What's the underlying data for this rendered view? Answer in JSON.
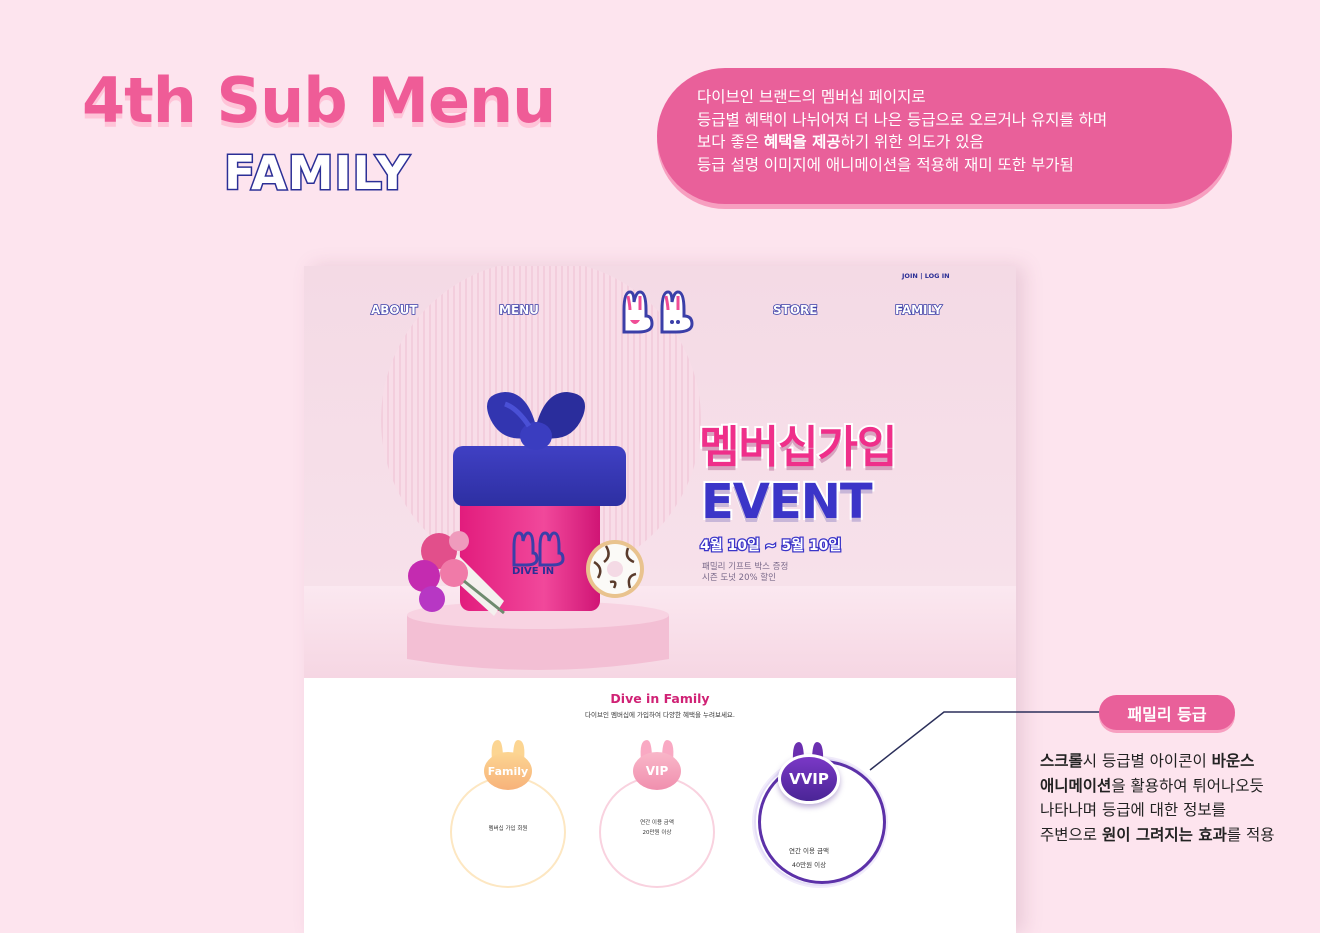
{
  "header": {
    "title": "4th Sub Menu",
    "subtitle": "FAMILY"
  },
  "description": {
    "line1": "다이브인 브랜드의 멤버십 페이지로",
    "line2": "등급별 혜택이 나뉘어져 더 나은 등급으로 오르거나 유지를 하며",
    "line3_pre": "보다 좋은 ",
    "line3_bold": "혜택을 제공",
    "line3_post": "하기 위한 의도가 있음",
    "line4": "등급 설명 이미지에 애니메이션을 적용해 재미 또한 부가됨"
  },
  "mockup": {
    "join_login": "JOIN | LOG IN",
    "nav": {
      "about": "ABOUT",
      "menu": "MENU",
      "store": "STORE",
      "family": "FAMILY"
    },
    "hero": {
      "event_title": "멤버십가입",
      "event_sub": "EVENT",
      "event_date": "4월 10일 ~ 5월 10일",
      "event_desc_1": "패밀리 기프트 박스 증정",
      "event_desc_2": "시즌 도넛 20% 할인",
      "box_brand": "DIVE IN"
    },
    "family": {
      "title": "Dive in Family",
      "subtitle": "다이브인 멤버십에 가입하여 다양한 혜택을 누려보세요.",
      "tiers": [
        {
          "name": "Family",
          "line1": "멤버십 가입 회원",
          "line2": ""
        },
        {
          "name": "VIP",
          "line1": "연간 이용 금액",
          "line2": "20만원 이상"
        },
        {
          "name": "VVIP",
          "line1": "연간 이용 금액",
          "line2": "40만원 이상"
        }
      ]
    }
  },
  "annotation": {
    "pill": "패밀리 등급",
    "l1_b1": "스크롤",
    "l1_t1": "시 등급별 아이콘이 ",
    "l1_b2": "바운스",
    "l2_b1": "애니메이션",
    "l2_t1": "을 활용하여 튀어나오듯",
    "l3": "나타나며 등급에 대한 정보를",
    "l4_t1": "주변으로 ",
    "l4_b1": "원이 그려지는 효과",
    "l4_t2": "를 적용"
  },
  "colors": {
    "background": "#fde4ee",
    "accent_pink": "#e9609a",
    "title_pink": "#ef5c97",
    "navy": "#2b2f96"
  }
}
